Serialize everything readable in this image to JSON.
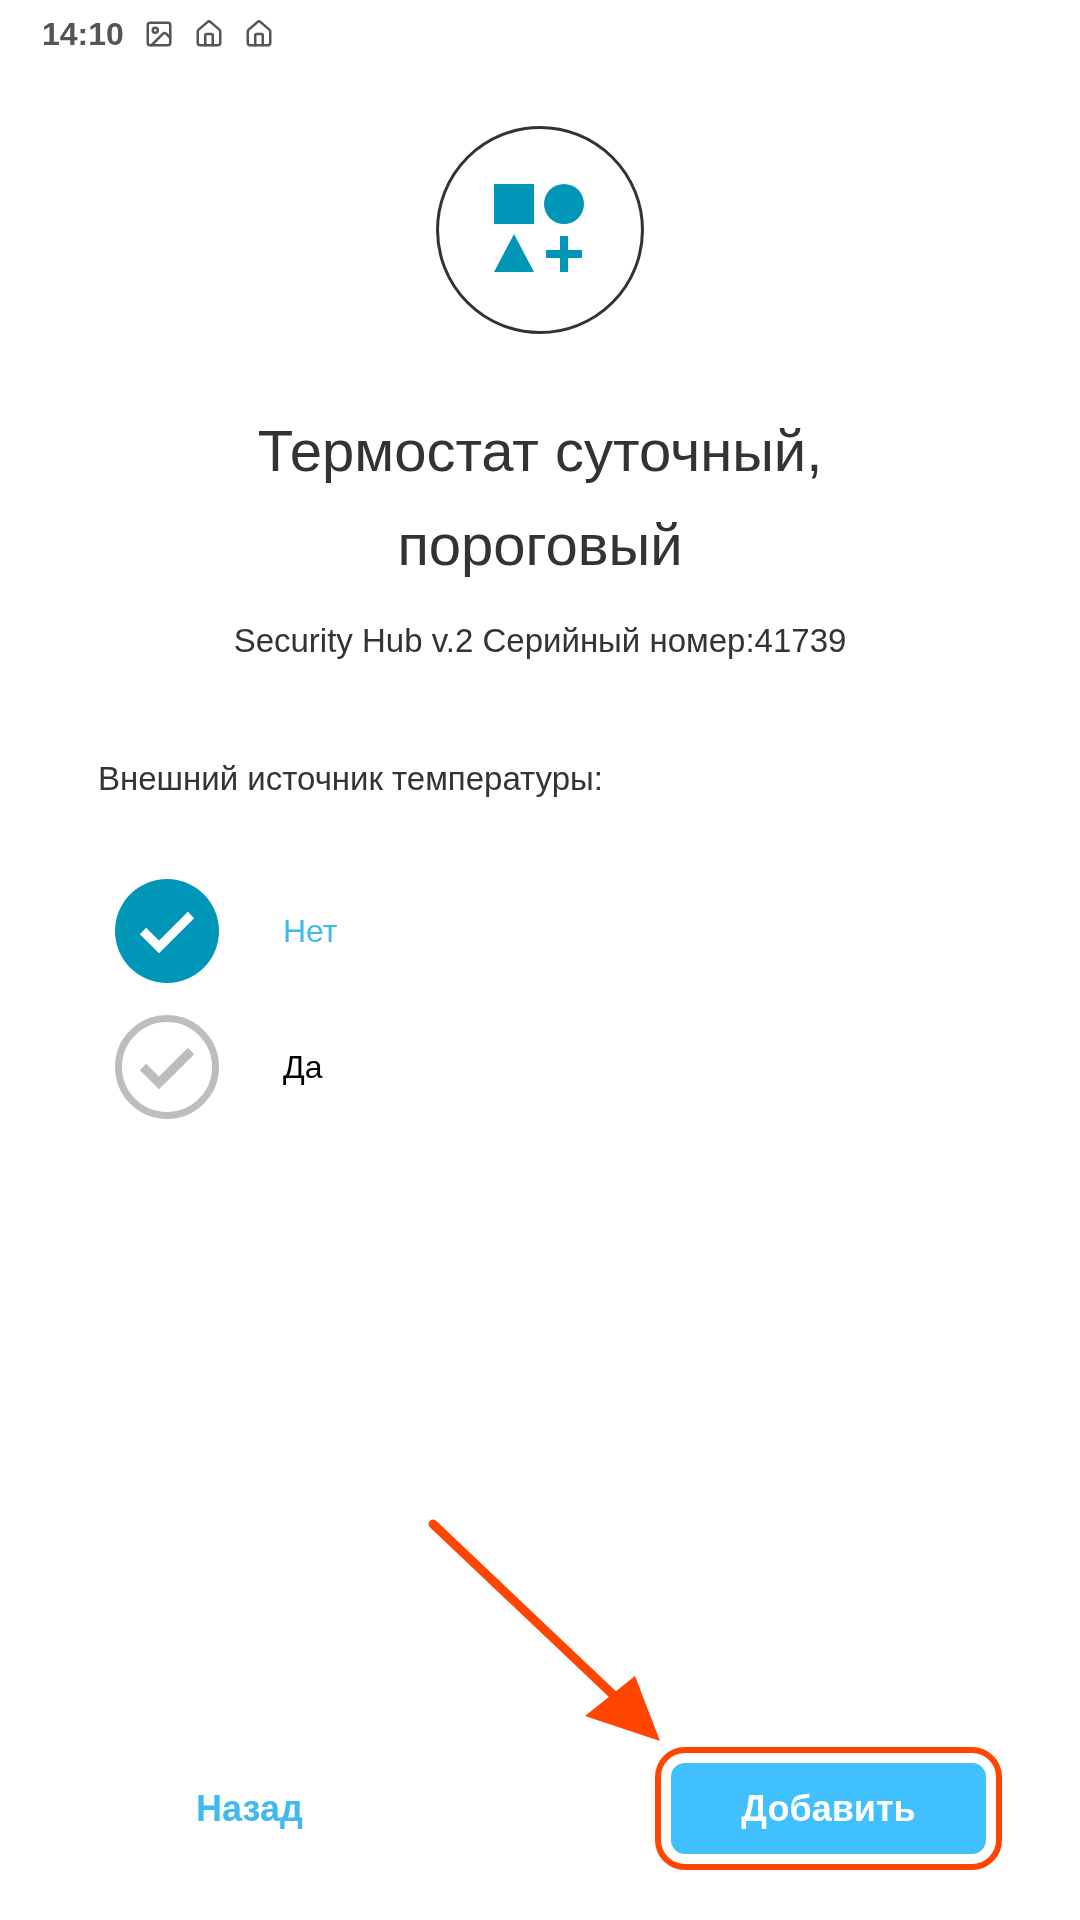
{
  "status_bar": {
    "time": "14:10"
  },
  "device": {
    "title": "Термостат суточный, пороговый",
    "subtitle": "Security Hub v.2 Серийный номер:41739"
  },
  "setting": {
    "label": "Внешний источник температуры:",
    "options": [
      {
        "label": "Нет",
        "selected": true
      },
      {
        "label": "Да",
        "selected": false
      }
    ]
  },
  "buttons": {
    "back": "Назад",
    "add": "Добавить"
  }
}
